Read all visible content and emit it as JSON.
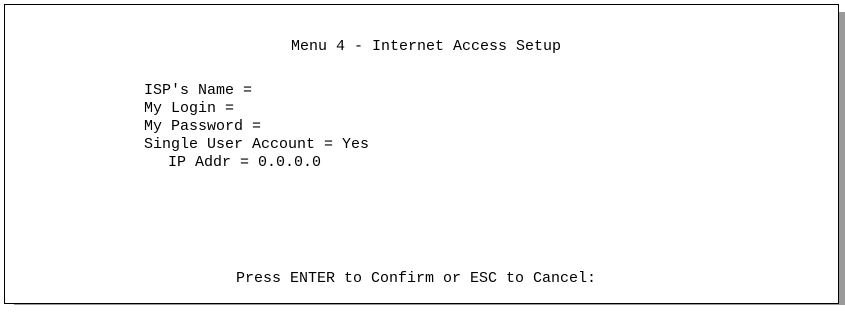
{
  "title": "Menu 4 - Internet Access Setup",
  "fields": [
    {
      "label": "ISP's Name = ",
      "value": ""
    },
    {
      "label": "My Login = ",
      "value": ""
    },
    {
      "label": "My Password = ",
      "value": ""
    },
    {
      "label": "Single User Account = ",
      "value": "Yes"
    },
    {
      "label": "IP Addr = ",
      "value": "0.0.0.0"
    }
  ],
  "prompt": "Press ENTER to Confirm or ESC to Cancel:",
  "colors": {
    "background": "#ffffff",
    "text": "#000000",
    "shadow": "#9a9a9a"
  }
}
